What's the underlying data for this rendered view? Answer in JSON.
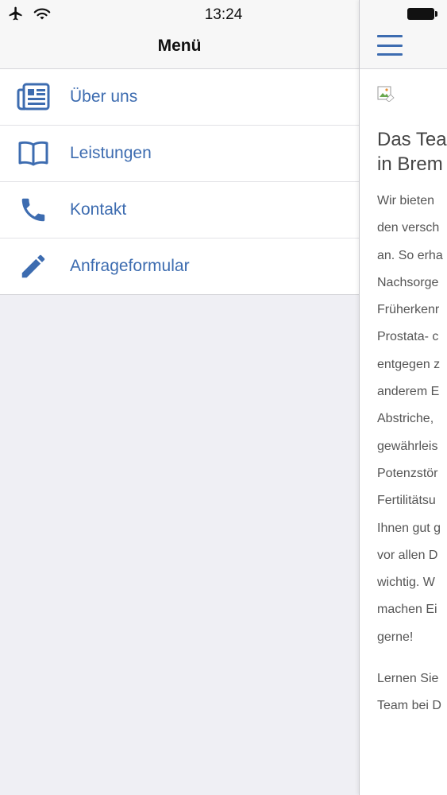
{
  "status": {
    "time": "13:24"
  },
  "menu": {
    "title": "Menü",
    "items": [
      {
        "label": "Über uns",
        "icon": "newspaper-icon"
      },
      {
        "label": "Leistungen",
        "icon": "book-icon"
      },
      {
        "label": "Kontakt",
        "icon": "phone-icon"
      },
      {
        "label": "Anfrageformular",
        "icon": "pencil-icon"
      }
    ]
  },
  "content": {
    "heading_lines": [
      "Das Tea",
      "in Brem"
    ],
    "paragraph1_lines": [
      "Wir bieten",
      "den versch",
      "an. So erha",
      "Nachsorge",
      "Früherkenr",
      "Prostata- c",
      "entgegen z",
      "anderem E",
      "Abstriche,",
      "gewährleis",
      "Potenzstör",
      "Fertilitätsu",
      "Ihnen gut g",
      "vor allen D",
      "wichtig. W",
      "machen Ei",
      "gerne!"
    ],
    "paragraph2_lines": [
      "Lernen Sie",
      "Team bei D"
    ]
  },
  "colors": {
    "accent": "#3d6cb0",
    "background": "#efeff4",
    "bar": "#f7f7f7"
  }
}
